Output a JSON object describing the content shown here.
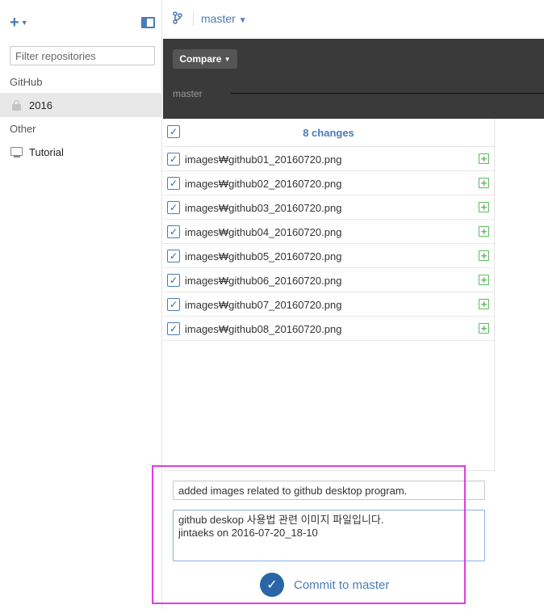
{
  "sidebar": {
    "add_label": "+",
    "filter_placeholder": "Filter repositories",
    "sections": [
      {
        "title": "GitHub",
        "items": [
          {
            "label": "2016",
            "icon": "lock-icon"
          }
        ]
      },
      {
        "title": "Other",
        "items": [
          {
            "label": "Tutorial",
            "icon": "monitor-icon"
          }
        ]
      }
    ]
  },
  "header": {
    "branch_icon": "branch-icon",
    "branch": "master",
    "compare_label": "Compare",
    "timeline_label": "master"
  },
  "changes": {
    "title": "8 changes",
    "files": [
      "images₩github01_20160720.png",
      "images₩github02_20160720.png",
      "images₩github03_20160720.png",
      "images₩github04_20160720.png",
      "images₩github05_20160720.png",
      "images₩github06_20160720.png",
      "images₩github07_20160720.png",
      "images₩github08_20160720.png"
    ]
  },
  "commit": {
    "summary": "added images related to github desktop program.",
    "description": "github deskop 사용법 관련 이미지 파일입니다.\njintaeks on 2016-07-20_18-10",
    "button_label": "Commit to master"
  },
  "colors": {
    "accent": "#4a7bb7",
    "added": "#5cb85c",
    "dark_bar": "#3a3a3a",
    "highlight": "#e03ce0"
  }
}
